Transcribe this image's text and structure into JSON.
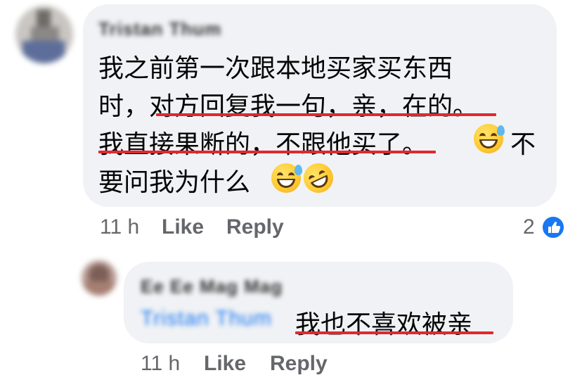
{
  "comment1": {
    "author": "Tristan Thum",
    "lines": [
      "我之前第一次跟本地买家买东西",
      "时，对方回复我一句，亲，在的。",
      "我直接果断的，不跟他买了。",
      "不",
      "要问我为什么"
    ],
    "time": "11 h",
    "like_label": "Like",
    "reply_label": "Reply",
    "reaction_count": "2"
  },
  "comment2": {
    "author": "Ee Ee Mag Mag",
    "tag": "Tristan Thum",
    "text": "我也不喜欢被亲",
    "time": "11 h",
    "like_label": "Like",
    "reply_label": "Reply"
  },
  "colors": {
    "bubble": "#f0f2f5",
    "underline": "#e0282f",
    "meta": "#65676b",
    "link": "#1877f2"
  },
  "icons": [
    "sweat-smile-emoji-icon",
    "grinning-sweat-emoji-icon",
    "rolling-laughing-emoji-icon",
    "like-reaction-icon"
  ]
}
